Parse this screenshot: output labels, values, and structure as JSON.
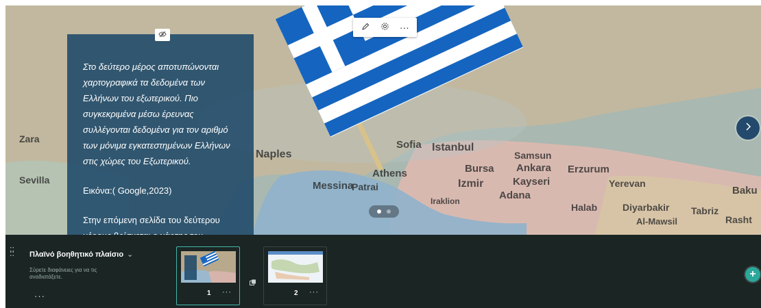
{
  "slide": {
    "background_image": "map-with-greek-flag-pin",
    "text_panel": {
      "paragraph_1": "Στο δεύτερο μέρος αποτυπώνονται χαρτογραφικά τα δεδομένα των Ελλήνων του εξωτερικού. Πιο συγκεκριμένα μέσω έρευνας συλλέγονται δεδομένα για τον αριθμό των μόνιμα εγκατεστημένων Ελλήνων στις χώρες του Εξωτερικού.",
      "line_1": "Στο δεύτερο μέρος αποτυπώνονται",
      "line_2": "χαρτογραφικά τα δεδομένα των",
      "line_3": "Ελλήνων του εξωτερικού. Πιο",
      "line_4": "συγκεκριμένα μέσω έρευνας",
      "line_5": "συλλέγονται δεδομένα για τον αριθμό",
      "line_6": "των μόνιμα εγκατεστημένων Ελλήνων",
      "line_7": "στις χώρες του Εξωτερικού.",
      "image_credit": "Εικόνα:( Google,2023)",
      "next_line_1": "Στην επόμενη σελίδα του δεύτερου",
      "next_line_2": "μέρους βρίσκεται ο χάρτης του"
    },
    "map_labels": [
      "Naples",
      "Messina",
      "Patrai",
      "Athens",
      "Sofia",
      "Istanbul",
      "Bursa",
      "Izmir",
      "Kayseri",
      "Adana",
      "Samsun",
      "Ankara",
      "Erzurum",
      "Yerevan",
      "Baku",
      "Diyarbakir",
      "Tabriz",
      "Rasht",
      "Halab",
      "Al-Mawsil",
      "Iraklion",
      "Sevilla",
      "Zara"
    ],
    "colors": {
      "panel": "#1a4668",
      "accent": "#45b8ac",
      "add_button": "#2aa89a",
      "nav_button": "#234a6c"
    }
  },
  "toolbar": {
    "edit_icon": "pencil-icon",
    "settings_icon": "gear-icon",
    "more_label": "···"
  },
  "pagination": {
    "current": 1,
    "total": 2
  },
  "tray": {
    "title": "Πλαϊνό βοηθητικό πλαίσιο",
    "hint": "Σύρετε διαφάνειες για να τις αναδιατάξετε.",
    "more_label": "···",
    "slides": [
      {
        "number": "1",
        "more_label": "···",
        "active": true
      },
      {
        "number": "2",
        "more_label": "···",
        "active": false
      }
    ],
    "add_label": "+"
  }
}
